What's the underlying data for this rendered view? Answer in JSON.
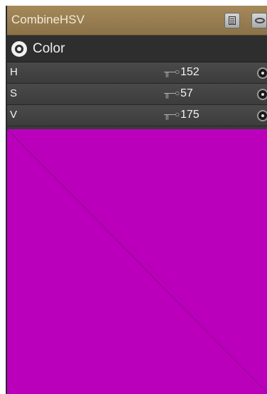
{
  "node": {
    "title": "CombineHSV",
    "title_buttons": [
      {
        "name": "list-icon"
      },
      {
        "name": "eye-icon"
      }
    ]
  },
  "section": {
    "label": "Color",
    "icon": "color-target-icon"
  },
  "params": [
    {
      "label": "H",
      "key_icon": "key-icon",
      "value": "152"
    },
    {
      "label": "S",
      "key_icon": "key-icon",
      "value": "57"
    },
    {
      "label": "V",
      "key_icon": "key-icon",
      "value": "175"
    }
  ],
  "preview": {
    "color": "#bb00bb",
    "line_color": "#8f0c8f"
  }
}
